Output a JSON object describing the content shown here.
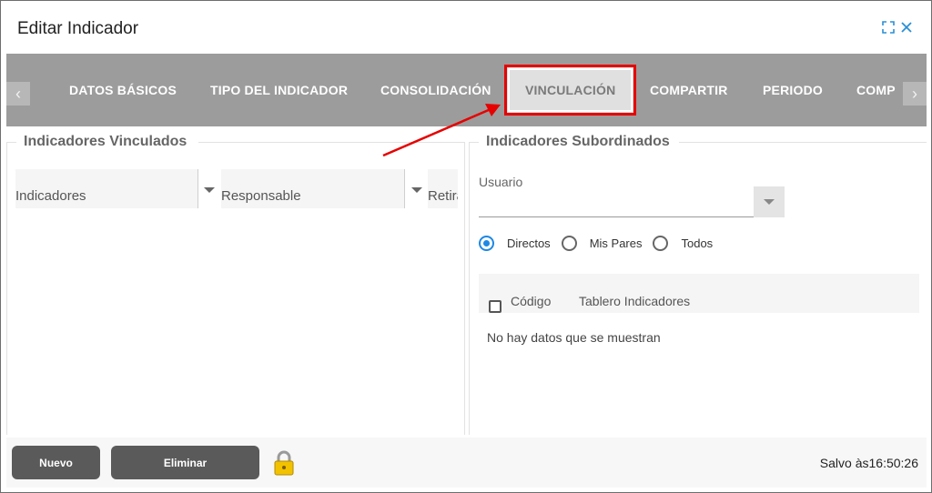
{
  "dialog": {
    "title": "Editar Indicador",
    "icons": {
      "expand": "expand-icon",
      "close": "close-icon"
    }
  },
  "tabs": [
    {
      "label": "DATOS BÁSICOS"
    },
    {
      "label": "TIPO DEL INDICADOR"
    },
    {
      "label": "CONSOLIDACIÓN"
    },
    {
      "label": "VINCULACIÓN",
      "active": true
    },
    {
      "label": "COMPARTIR"
    },
    {
      "label": "PERIODO"
    },
    {
      "label": "COMP"
    }
  ],
  "left_panel": {
    "title": "Indicadores Vinculados",
    "columns": [
      "Indicadores",
      "Responsable",
      "Retira"
    ]
  },
  "right_panel": {
    "title": "Indicadores Subordinados",
    "usuario_label": "Usuario",
    "usuario_value": "",
    "radios": [
      {
        "label": "Directos",
        "checked": true
      },
      {
        "label": "Mis Pares",
        "checked": false
      },
      {
        "label": "Todos",
        "checked": false
      }
    ],
    "columns": [
      "Código",
      "Tablero Indicadores"
    ],
    "empty_text": "No hay datos que se muestran"
  },
  "footer": {
    "nuevo_label": "Nuevo",
    "eliminar_label": "Eliminar",
    "saved_text": "Salvo às16:50:26"
  },
  "colors": {
    "tabbar": "#9c9c9c",
    "highlight": "#e60000",
    "accent": "#1e88e5",
    "button": "#5a5a5a"
  }
}
